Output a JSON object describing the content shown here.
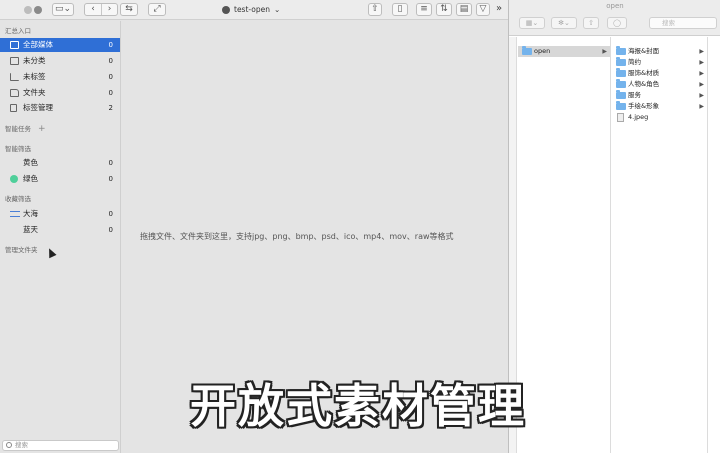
{
  "app": {
    "title": "test-open",
    "title_chevron": "⌄"
  },
  "toolbar": {
    "back": "‹",
    "forward": "›",
    "more": "»"
  },
  "sidebar": {
    "section_quick": "汇总入口",
    "quick_items": [
      {
        "label": "全部媒体",
        "count": "0",
        "icon": "media-icon"
      },
      {
        "label": "未分类",
        "count": "0",
        "icon": "uncategorized-icon"
      },
      {
        "label": "未标签",
        "count": "0",
        "icon": "untagged-icon"
      },
      {
        "label": "文件夹",
        "count": "0",
        "icon": "folder-icon"
      },
      {
        "label": "标签管理",
        "count": "2",
        "icon": "tag-icon"
      }
    ],
    "section_smart_tasks": "智能任务",
    "smart_tasks_add": "+",
    "section_smart_filter": "智能筛选",
    "filter_items": [
      {
        "label": "黄色",
        "count": "0",
        "color": ""
      },
      {
        "label": "绿色",
        "count": "0",
        "color": "#4fcf9a"
      }
    ],
    "section_favorites": "收藏筛选",
    "favorite_items": [
      {
        "label": "大海",
        "count": "0"
      },
      {
        "label": "蓝天",
        "count": "0"
      }
    ],
    "section_manage_folders": "管理文件夹",
    "search_placeholder": "搜索"
  },
  "main": {
    "drop_hint": "拖拽文件、文件夹到这里，支持jpg、png、bmp、psd、ico、mp4、mov、raw等格式"
  },
  "finder": {
    "title": "open",
    "search_placeholder": "搜索",
    "column1": [
      {
        "name": "open",
        "type": "folder",
        "selected": true
      }
    ],
    "column2": [
      {
        "name": "海报&封面",
        "type": "folder"
      },
      {
        "name": "简约",
        "type": "folder"
      },
      {
        "name": "服饰&材质",
        "type": "folder"
      },
      {
        "name": "人物&角色",
        "type": "folder"
      },
      {
        "name": "服务",
        "type": "folder"
      },
      {
        "name": "手绘&形象",
        "type": "folder"
      },
      {
        "name": "4.jpeg",
        "type": "file"
      }
    ]
  },
  "overlay": {
    "caption": "开放式素材管理"
  },
  "colors": {
    "accent": "#2f6fd6",
    "folder": "#74b3ec",
    "green_tag": "#4fcf9a"
  }
}
